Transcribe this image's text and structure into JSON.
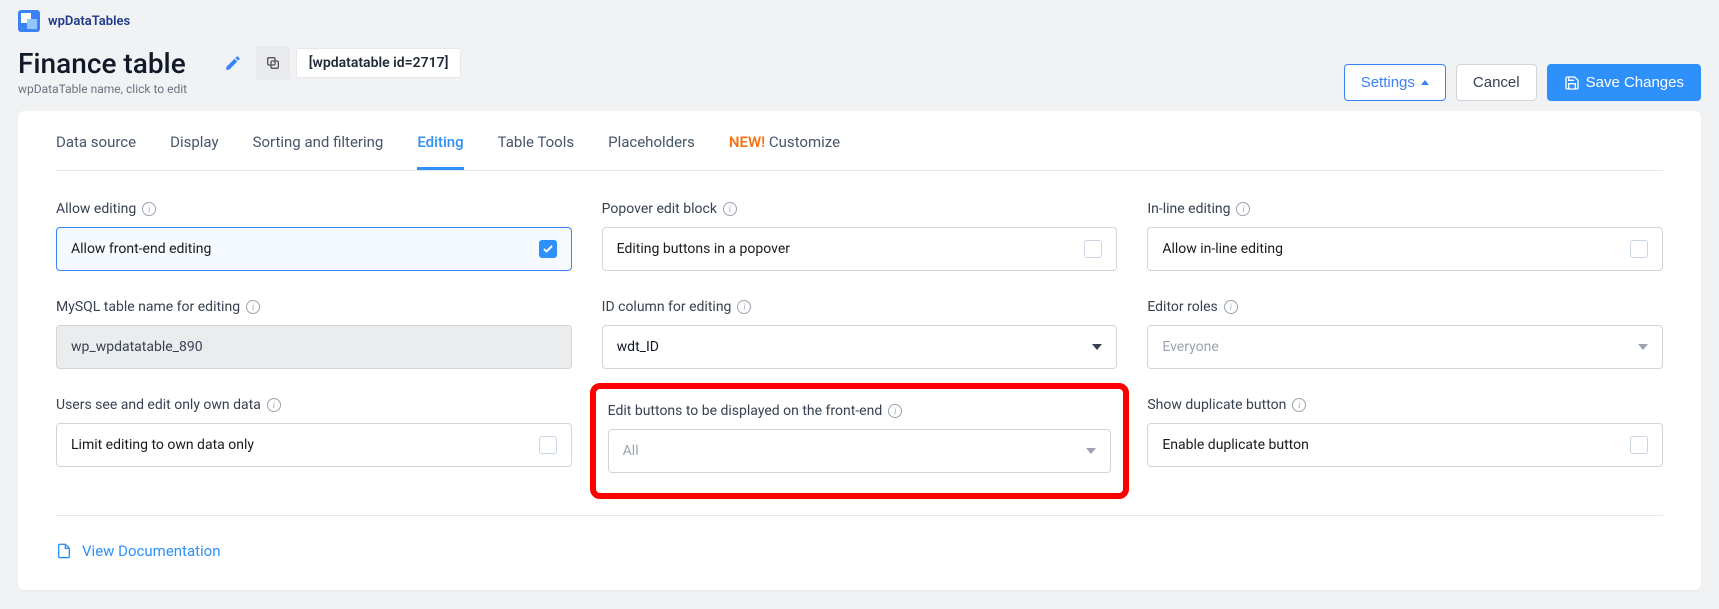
{
  "brand": "wpDataTables",
  "title": "Finance table",
  "subtitle": "wpDataTable name, click to edit",
  "shortcode": "[wpdatatable id=2717]",
  "buttons": {
    "settings": "Settings",
    "cancel": "Cancel",
    "save": "Save Changes"
  },
  "tabs": [
    "Data source",
    "Display",
    "Sorting and filtering",
    "Editing",
    "Table Tools",
    "Placeholders",
    "Customize"
  ],
  "tabs_new_prefix": "NEW!",
  "fields": {
    "allow_editing": {
      "label": "Allow editing",
      "option": "Allow front-end editing",
      "checked": true
    },
    "popover": {
      "label": "Popover edit block",
      "option": "Editing buttons in a popover",
      "checked": false
    },
    "inline": {
      "label": "In-line editing",
      "option": "Allow in-line editing",
      "checked": false
    },
    "mysql": {
      "label": "MySQL table name for editing",
      "value": "wp_wpdatatable_890"
    },
    "idcol": {
      "label": "ID column for editing",
      "value": "wdt_ID"
    },
    "roles": {
      "label": "Editor roles",
      "placeholder": "Everyone"
    },
    "own": {
      "label": "Users see and edit only own data",
      "option": "Limit editing to own data only",
      "checked": false
    },
    "editbtns": {
      "label": "Edit buttons to be displayed on the front-end",
      "value": "All"
    },
    "dup": {
      "label": "Show duplicate button",
      "option": "Enable duplicate button",
      "checked": false
    }
  },
  "doc_link": "View Documentation"
}
